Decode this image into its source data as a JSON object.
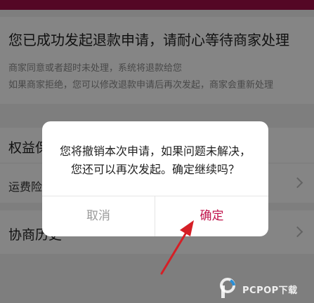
{
  "status": {
    "title": "您已成功发起退款申请，请耐心等待商家处理",
    "line1": "商家同意或者超时未处理，系统将退款给您",
    "line2": "如果商家拒绝，您可以修改退款申请后再次发起，商家会重新处理"
  },
  "sections": {
    "rights_title": "权益保障",
    "freight_label": "运费险",
    "consult_label": "协商历史"
  },
  "dialog": {
    "message_line1": "您将撤销本次申请，如果问题未解决，",
    "message_line2": "您还可以再次发起。确定继续吗？",
    "cancel_label": "取消",
    "confirm_label": "确定"
  },
  "watermark": {
    "text": "PCPOP下载"
  },
  "colors": {
    "brand": "#a10f47",
    "confirm": "#c0144b",
    "arrow": "#d51f26"
  }
}
